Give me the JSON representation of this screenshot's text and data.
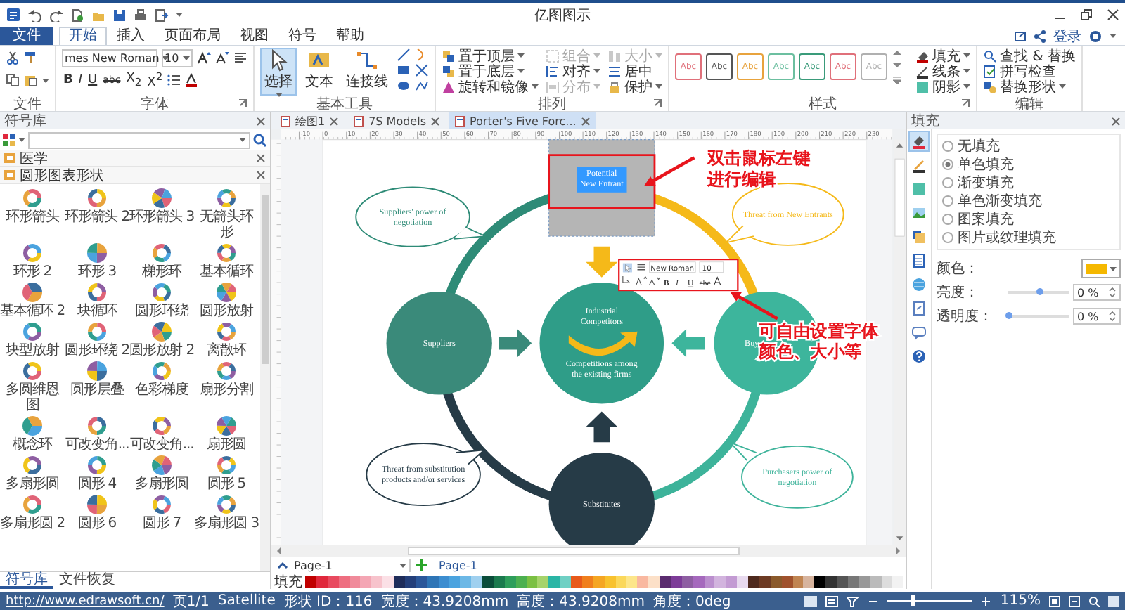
{
  "window": {
    "title": "亿图图示"
  },
  "menu": {
    "file": "文件",
    "tabs": [
      {
        "label": "开始",
        "selected": true
      },
      {
        "label": "插入",
        "selected": false
      },
      {
        "label": "页面布局",
        "selected": false
      },
      {
        "label": "视图",
        "selected": false
      },
      {
        "label": "符号",
        "selected": false
      },
      {
        "label": "帮助",
        "selected": false
      }
    ],
    "login": "登录"
  },
  "ribbon": {
    "clipboard": {
      "label": "文件"
    },
    "font": {
      "family": "mes New Roman",
      "size": "10",
      "format_buttons": [
        "B",
        "I",
        "U",
        "abc",
        "X$_{2}$",
        "X$^{2}$"
      ],
      "label": "字体"
    },
    "tools": {
      "items": [
        {
          "label": "选择",
          "selected": true
        },
        {
          "label": "文本",
          "selected": false
        },
        {
          "label": "连接线",
          "selected": false
        }
      ],
      "label": "基本工具"
    },
    "arrange": {
      "items": [
        {
          "label": "置于顶层",
          "disabled": false
        },
        {
          "label": "组合",
          "disabled": true
        },
        {
          "label": "大小",
          "disabled": true
        },
        {
          "label": "置于底层",
          "disabled": false
        },
        {
          "label": "对齐",
          "disabled": false
        },
        {
          "label": "居中",
          "disabled": false
        },
        {
          "label": "旋转和镜像",
          "disabled": false
        },
        {
          "label": "分布",
          "disabled": true
        },
        {
          "label": "保护",
          "disabled": false
        }
      ],
      "label": "排列"
    },
    "styles": {
      "items": [
        {
          "label": "Abc",
          "color": "#e0707a"
        },
        {
          "label": "Abc",
          "color": "#555555"
        },
        {
          "label": "Abc",
          "color": "#e8a33d"
        },
        {
          "label": "Abc",
          "color": "#6cbfa0"
        },
        {
          "label": "Abc",
          "color": "#3a9b7a"
        },
        {
          "label": "Abc",
          "color": "#e0707a"
        },
        {
          "label": "Abc",
          "color": "#b0b0b0"
        }
      ],
      "format": [
        "填充",
        "线条",
        "阴影"
      ],
      "label": "样式"
    },
    "edit": {
      "items": [
        "查找 & 替换",
        "拼写检查",
        "替换形状"
      ],
      "label": "编辑"
    }
  },
  "library": {
    "title": "符号库",
    "categories": [
      "医学",
      "圆形图表形状"
    ],
    "shapes": [
      "环形箭头",
      "环形箭头 2",
      "环形箭头 3",
      "无箭头环形",
      "环形 2",
      "环形 3",
      "梯形环",
      "基本循环",
      "基本循环 2",
      "块循环",
      "圆形环绕",
      "圆形放射",
      "块型放射",
      "圆形环绕 2",
      "圆形放射 2",
      "离散环",
      "多圆维恩图",
      "圆形层叠",
      "色彩梯度",
      "扇形分割",
      "概念环",
      "可改变角...",
      "可改变角...",
      "扇形圆",
      "多扇形圆",
      "圆形 4",
      "多扇形圆",
      "圆形 5",
      "多扇形圆 2",
      "圆形 6",
      "圆形 7",
      "多扇形圆 3"
    ],
    "tabs": [
      {
        "label": "符号库",
        "selected": true
      },
      {
        "label": "文件恢复",
        "selected": false
      }
    ]
  },
  "documents": {
    "tabs": [
      {
        "label": "绘图1",
        "selected": false
      },
      {
        "label": "7S Models",
        "selected": false
      },
      {
        "label": "Porter's Five Forc...",
        "selected": true
      }
    ]
  },
  "ruler": {
    "labels": [
      "-10",
      "0",
      "10",
      "20",
      "30",
      "40",
      "50",
      "60",
      "70",
      "80",
      "90",
      "100",
      "110",
      "120",
      "130",
      "140",
      "150",
      "160",
      "170",
      "180",
      "190",
      "200",
      "210",
      "220",
      "230"
    ]
  },
  "diagram": {
    "selected_box": {
      "lines": [
        "Potential",
        "New Entrant"
      ]
    },
    "center": {
      "title": [
        "Industrial",
        "Competitors"
      ],
      "subtitle": [
        "Competitions among",
        "the existing firms"
      ],
      "color": "#2f9d88"
    },
    "forces": [
      {
        "lines": [
          "Suppliers"
        ],
        "color": "#3a8a7a"
      },
      {
        "lines": [
          "Buy"
        ],
        "color": "#3db59c"
      },
      {
        "lines": [
          "Substitutes"
        ],
        "color": "#263b47"
      }
    ],
    "callouts": [
      {
        "lines": [
          "Suppliers' power of",
          "negotiation"
        ],
        "color": "#2e8b77"
      },
      {
        "lines": [
          "Threat from New Entrants"
        ],
        "color": "#f5b919"
      },
      {
        "lines": [
          "Threat from substitution",
          "products and/or services"
        ],
        "color": "#263b47"
      },
      {
        "lines": [
          "Purchasers power of",
          "negotiation"
        ],
        "color": "#3db39a"
      }
    ],
    "mini_toolbar": {
      "font": "New Roman",
      "size": "10",
      "buttons": [
        "B",
        "I",
        "U",
        "abc"
      ]
    },
    "annotations": [
      {
        "lines": [
          "双击鼠标左键",
          "进行编辑"
        ]
      },
      {
        "lines": [
          "可自由设置字体",
          "颜色、大小等"
        ]
      }
    ]
  },
  "pages": {
    "dropdown": "Page-1",
    "tabs": [
      {
        "label": "Page-1",
        "selected": true
      }
    ]
  },
  "palette": {
    "label": "填充",
    "swatches": [
      {
        "color": "#c00000"
      },
      {
        "color": "#e0283c"
      },
      {
        "color": "#e84a5f"
      },
      {
        "color": "#ee6e80"
      },
      {
        "color": "#f08a9a"
      },
      {
        "color": "#f4a6b4"
      },
      {
        "color": "#f7c3cc"
      },
      {
        "color": "#fbe0e6"
      },
      {
        "color": "#1f2d5a"
      },
      {
        "color": "#243f7a"
      },
      {
        "color": "#2b579a"
      },
      {
        "color": "#2e75b6"
      },
      {
        "color": "#3c8dd0"
      },
      {
        "color": "#4aa3df"
      },
      {
        "color": "#6cb8e6"
      },
      {
        "color": "#9fd0ef"
      },
      {
        "color": "#0b4d3a"
      },
      {
        "color": "#1b7a4e"
      },
      {
        "color": "#2e9e5b"
      },
      {
        "color": "#4cb050"
      },
      {
        "color": "#7bc043"
      },
      {
        "color": "#a6d36b"
      },
      {
        "color": "#2ab5a5"
      },
      {
        "color": "#6fd0c4"
      },
      {
        "color": "#e85a1b"
      },
      {
        "color": "#f07f1d"
      },
      {
        "color": "#f5a623"
      },
      {
        "color": "#f8c22e"
      },
      {
        "color": "#fbd85b"
      },
      {
        "color": "#fde68a"
      },
      {
        "color": "#f9b8a0"
      },
      {
        "color": "#fce0c8"
      },
      {
        "color": "#5b2c6f"
      },
      {
        "color": "#7d3c98"
      },
      {
        "color": "#8e5ea2"
      },
      {
        "color": "#a569bd"
      },
      {
        "color": "#bb8fce"
      },
      {
        "color": "#d2b4de"
      },
      {
        "color": "#c39bd3"
      },
      {
        "color": "#e8daef"
      },
      {
        "color": "#4e2a1e"
      },
      {
        "color": "#6d3b24"
      },
      {
        "color": "#8b5a2b"
      },
      {
        "color": "#a0522d"
      },
      {
        "color": "#c08552"
      },
      {
        "color": "#d7b49e"
      },
      {
        "color": "#000000"
      },
      {
        "color": "#333333"
      },
      {
        "color": "#555555"
      },
      {
        "color": "#777777"
      },
      {
        "color": "#999999"
      },
      {
        "color": "#bbbbbb"
      },
      {
        "color": "#dddddd"
      },
      {
        "color": "#f2f2f2"
      }
    ]
  },
  "fill": {
    "title": "填充",
    "side_tabs": [
      {
        "selected": true
      },
      {
        "selected": false
      },
      {
        "selected": false
      },
      {
        "selected": false
      },
      {
        "selected": false
      },
      {
        "selected": false
      },
      {
        "selected": false
      },
      {
        "selected": false
      },
      {
        "selected": false
      },
      {
        "selected": false
      }
    ],
    "options": [
      {
        "label": "无填充",
        "selected": false
      },
      {
        "label": "单色填充",
        "selected": true
      },
      {
        "label": "渐变填充",
        "selected": false
      },
      {
        "label": "单色渐变填充",
        "selected": false
      },
      {
        "label": "图案填充",
        "selected": false
      },
      {
        "label": "图片或纹理填充",
        "selected": false
      }
    ],
    "color": {
      "label": "颜色：",
      "color": "#f5b800"
    },
    "brightness": {
      "label": "亮度：",
      "level": 0.5,
      "value": "0 %"
    },
    "transparency": {
      "label": "透明度：",
      "level": 0.0,
      "value": "0 %"
    }
  },
  "status": {
    "link": "http://www.edrawsoft.cn/",
    "items": [
      "页1/1",
      "Satellite",
      "形状 ID：116",
      "宽度：43.9208mm",
      "高度：43.9208mm",
      "角度：0deg"
    ],
    "zoom": {
      "level": 0.3,
      "value": "115%"
    }
  }
}
